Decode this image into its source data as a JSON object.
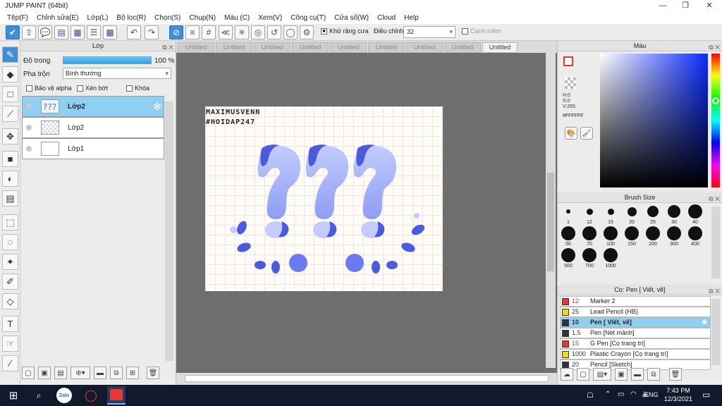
{
  "window": {
    "title": "JUMP PAINT (64bit)",
    "controls": [
      "—",
      "❐",
      "✕"
    ]
  },
  "menu": [
    "Tệp(F)",
    "Chỉnh sửa(E)",
    "Lớp(L)",
    "Bộ lọc(R)",
    "Chọn(S)",
    "Chụp(N)",
    "Màu (C)",
    "Xem(V)",
    "Công cụ(T)",
    "Cửa số(W)",
    "Cloud",
    "Help"
  ],
  "toolbar": {
    "antialias_label": "Khử răng cưa",
    "adjust_label": "Điều chỉnh",
    "adjust_value": "32",
    "margin_label": "Cạnh mềm"
  },
  "layer_panel": {
    "title": "Lớp",
    "opacity_label": "Độ trong",
    "opacity_value": "100 %",
    "opacity_fraction": 1.0,
    "blend_label": "Pha trộn",
    "blend_value": "Bình thường",
    "protect_alpha": "Bảo vệ alpha",
    "clip": "Xén bớt",
    "lock": "Khóa",
    "layers": [
      "Lớp2",
      "Lớp2",
      "Lớp1"
    ]
  },
  "canvas": {
    "tabs": [
      "Untitled",
      "Untitled",
      "Untitled",
      "Untitled",
      "Untitled",
      "Untitled",
      "Untitled",
      "Untitled",
      "Untitled"
    ],
    "text_line1": "MAXIMUSVENN",
    "text_line2": "#HOIDAP247",
    "colors": {
      "marks": "#4a5be0",
      "light": "#a9b6f6"
    }
  },
  "color_panel": {
    "title": "Màu",
    "h": "H:0",
    "s": "S:0",
    "v": "V:255",
    "hex": "#FFFFFF"
  },
  "brush_size": {
    "title": "Brush Size",
    "sizes": [
      "1",
      "12",
      "15",
      "20",
      "25",
      "30",
      "40",
      "50",
      "70",
      "100",
      "150",
      "200",
      "300",
      "400",
      "500",
      "700",
      "1000"
    ]
  },
  "brush_list": {
    "title": "Cọ: Pen [ Viết, vẽ]",
    "items": [
      {
        "size": "12",
        "name": "Marker 2",
        "color": "#e53935"
      },
      {
        "size": "25",
        "name": "Lead Pencil (HB)",
        "color": "#f5d90a"
      },
      {
        "size": "10",
        "name": "Pen [ Viết, vẽ]",
        "color": "#333333"
      },
      {
        "size": "1.5",
        "name": "Pen [Nét mảnh]",
        "color": "#333333"
      },
      {
        "size": "15",
        "name": "G Pen [Cọ trang trí]",
        "color": "#e53935"
      },
      {
        "size": "1000",
        "name": "Plastic Crayon [Cọ trang trí]",
        "color": "#f5d90a"
      },
      {
        "size": "20",
        "name": "Pencil [Sketch]",
        "color": "#333333"
      }
    ]
  },
  "taskbar": {
    "tray_lang": "ENG",
    "time": "7:43 PM",
    "date": "12/3/2021",
    "app_zalo": "Zalo"
  }
}
